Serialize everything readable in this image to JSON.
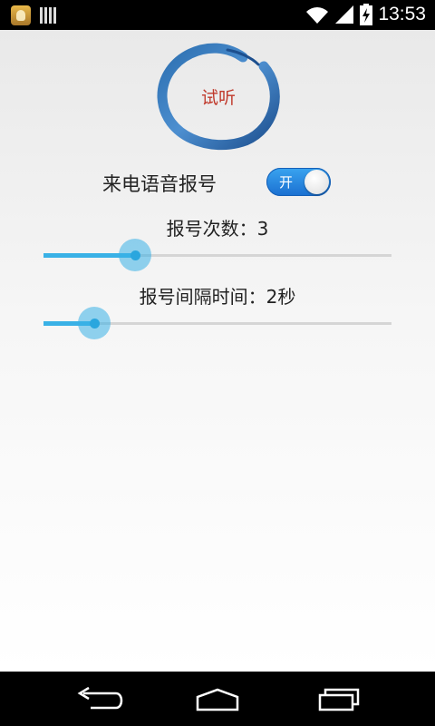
{
  "status_bar": {
    "time": "13:53",
    "icons": [
      "app-notification-icon",
      "barcode-icon",
      "wifi-icon",
      "signal-icon",
      "battery-charging-icon"
    ]
  },
  "listen_button": {
    "label": "试听"
  },
  "voice_toggle": {
    "label": "来电语音报号",
    "state_text": "开",
    "on": true
  },
  "repeat_count": {
    "label": "报号次数：3",
    "value_fraction": 0.264
  },
  "interval": {
    "label": "报号间隔时间：2秒",
    "value_fraction": 0.145
  },
  "nav_bar": {
    "icons": [
      "back-icon",
      "home-icon",
      "recent-apps-icon"
    ]
  },
  "colors": {
    "accent": "#39b1e6",
    "listen_text": "#c0392b",
    "switch": "#1a6fd0"
  }
}
